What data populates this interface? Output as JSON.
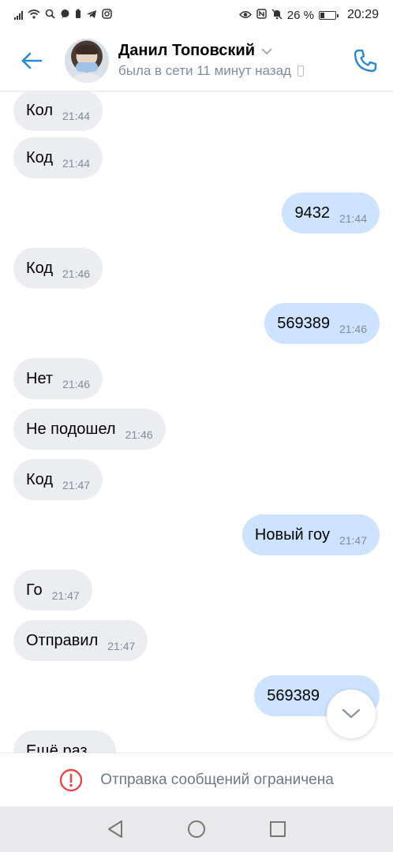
{
  "status_bar": {
    "battery": "26 %",
    "time": "20:29"
  },
  "header": {
    "name": "Данил Топовский",
    "last_seen": "была в сети 11 минут назад"
  },
  "messages": [
    {
      "dir": "in",
      "text": "Кол",
      "time": "21:44"
    },
    {
      "dir": "in",
      "text": "Код",
      "time": "21:44"
    },
    {
      "dir": "out",
      "text": "9432",
      "time": "21:44"
    },
    {
      "dir": "in",
      "text": "Код",
      "time": "21:46"
    },
    {
      "dir": "out",
      "text": "569389",
      "time": "21:46"
    },
    {
      "dir": "in",
      "text": "Нет",
      "time": "21:46"
    },
    {
      "dir": "in",
      "text": "Не подошел",
      "time": "21:46"
    },
    {
      "dir": "in",
      "text": "Код",
      "time": "21:47"
    },
    {
      "dir": "out",
      "text": "Новый гоу",
      "time": "21:47"
    },
    {
      "dir": "in",
      "text": "Го",
      "time": "21:47"
    },
    {
      "dir": "in",
      "text": "Отправил",
      "time": "21:47"
    },
    {
      "dir": "out",
      "text": "569389",
      "time": ""
    },
    {
      "dir": "in",
      "text": "Ещё раз",
      "time": ""
    }
  ],
  "restriction": {
    "text": "Отправка сообщений ограничена"
  },
  "colors": {
    "accent": "#2a88d9",
    "incoming_bubble": "#ebedf0",
    "outgoing_bubble": "#cce4ff",
    "warning": "#e64646"
  }
}
